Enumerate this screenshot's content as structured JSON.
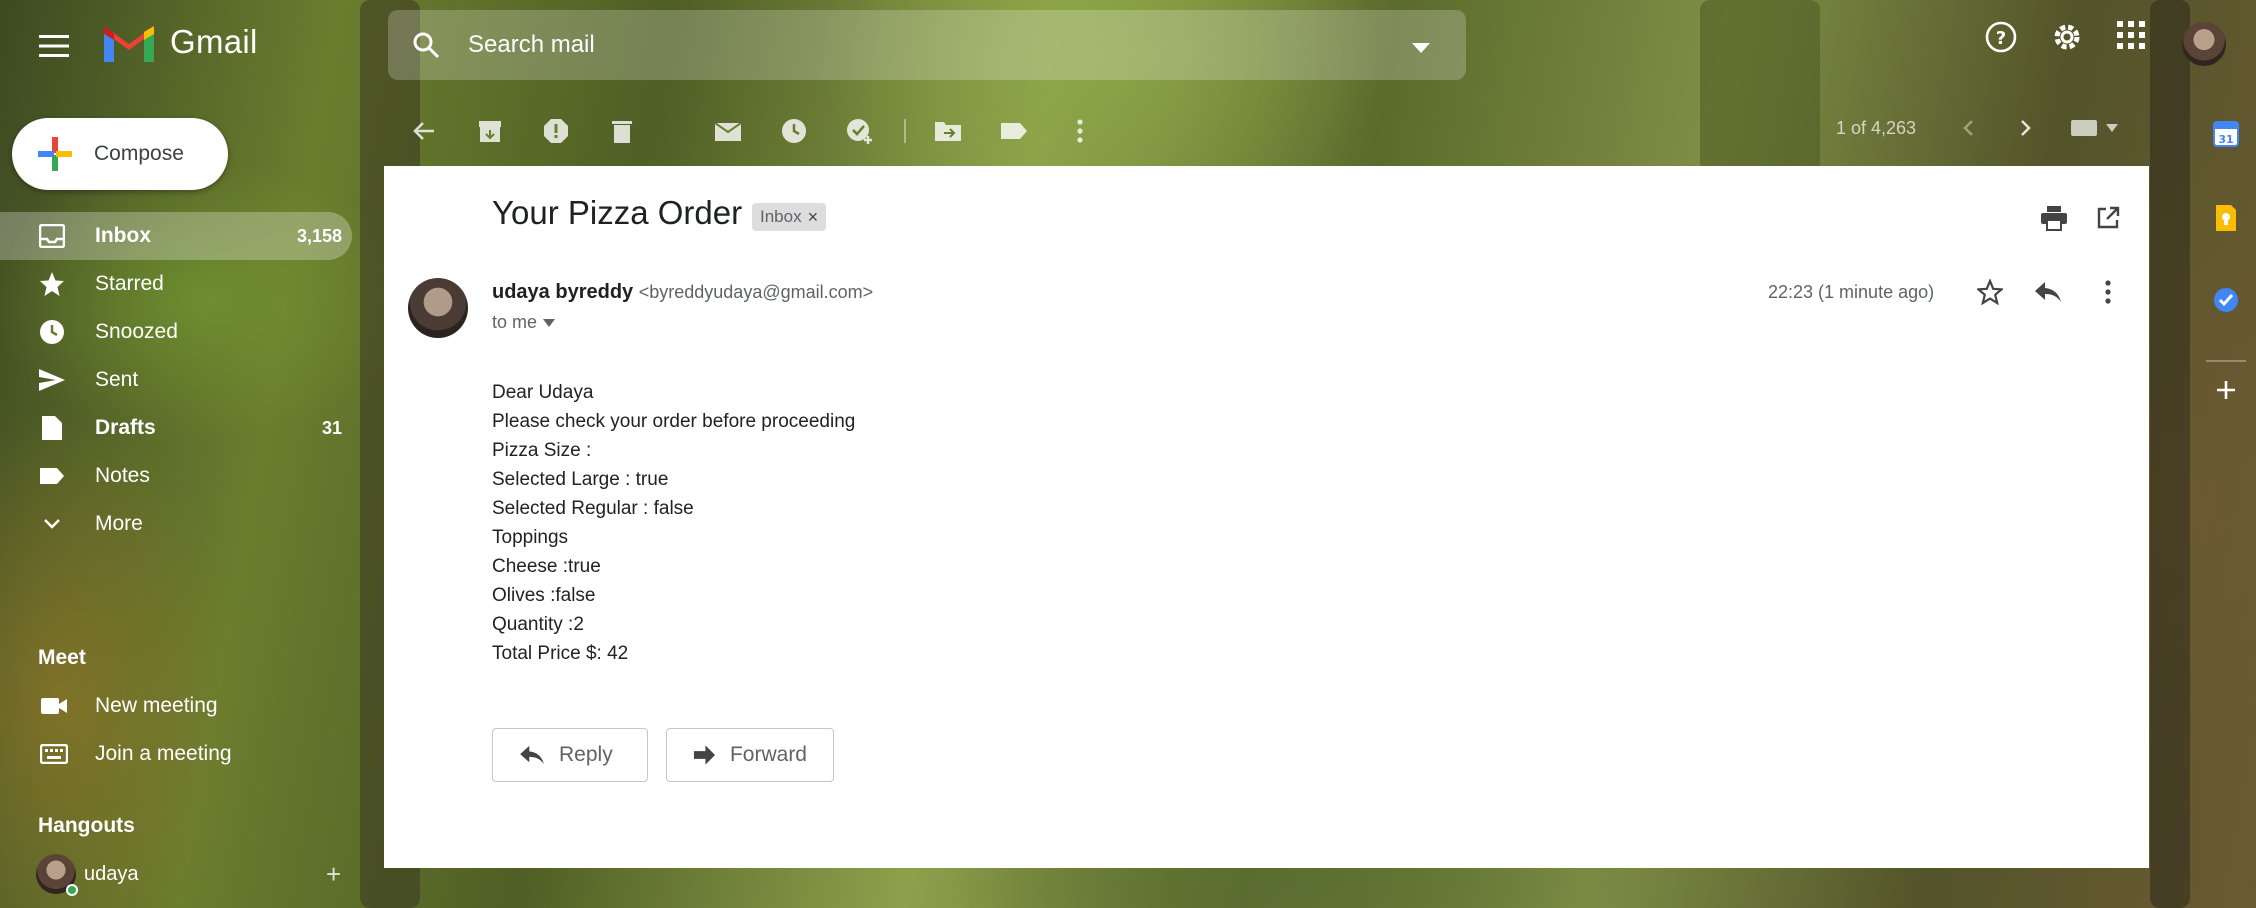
{
  "app": {
    "name": "Gmail"
  },
  "search": {
    "placeholder": "Search mail"
  },
  "sidebar": {
    "compose_label": "Compose",
    "items": [
      {
        "label": "Inbox",
        "count": "3,158",
        "icon": "inbox-icon"
      },
      {
        "label": "Starred",
        "count": "",
        "icon": "star-icon"
      },
      {
        "label": "Snoozed",
        "count": "",
        "icon": "clock-icon"
      },
      {
        "label": "Sent",
        "count": "",
        "icon": "send-icon"
      },
      {
        "label": "Drafts",
        "count": "31",
        "icon": "draft-icon"
      },
      {
        "label": "Notes",
        "count": "",
        "icon": "label-icon"
      },
      {
        "label": "More",
        "count": "",
        "icon": "chevron-down-icon"
      }
    ],
    "meet": {
      "title": "Meet",
      "new_meeting": "New meeting",
      "join_meeting": "Join a meeting"
    },
    "hangouts": {
      "title": "Hangouts",
      "user": "udaya"
    }
  },
  "toolbar": {
    "pager": "1 of 4,263"
  },
  "email": {
    "subject": "Your Pizza Order",
    "label": "Inbox",
    "sender_name": "udaya byreddy",
    "sender_email": "<byreddyudaya@gmail.com>",
    "to": "to me",
    "timestamp": "22:23 (1 minute ago)",
    "body": [
      "Dear Udaya",
      "Please check your order before proceeding",
      "Pizza Size :",
      "Selected Large : true",
      "Selected Regular : false",
      "Toppings",
      "Cheese :true",
      "Olives :false",
      "Quantity :2",
      "Total Price $: 42"
    ],
    "reply_label": "Reply",
    "forward_label": "Forward"
  },
  "rail": {
    "calendar_day": "31"
  },
  "colors": {
    "accent_red": "#ea4335",
    "accent_blue": "#4285f4",
    "accent_yellow": "#fbbc04",
    "accent_green": "#34a853"
  }
}
